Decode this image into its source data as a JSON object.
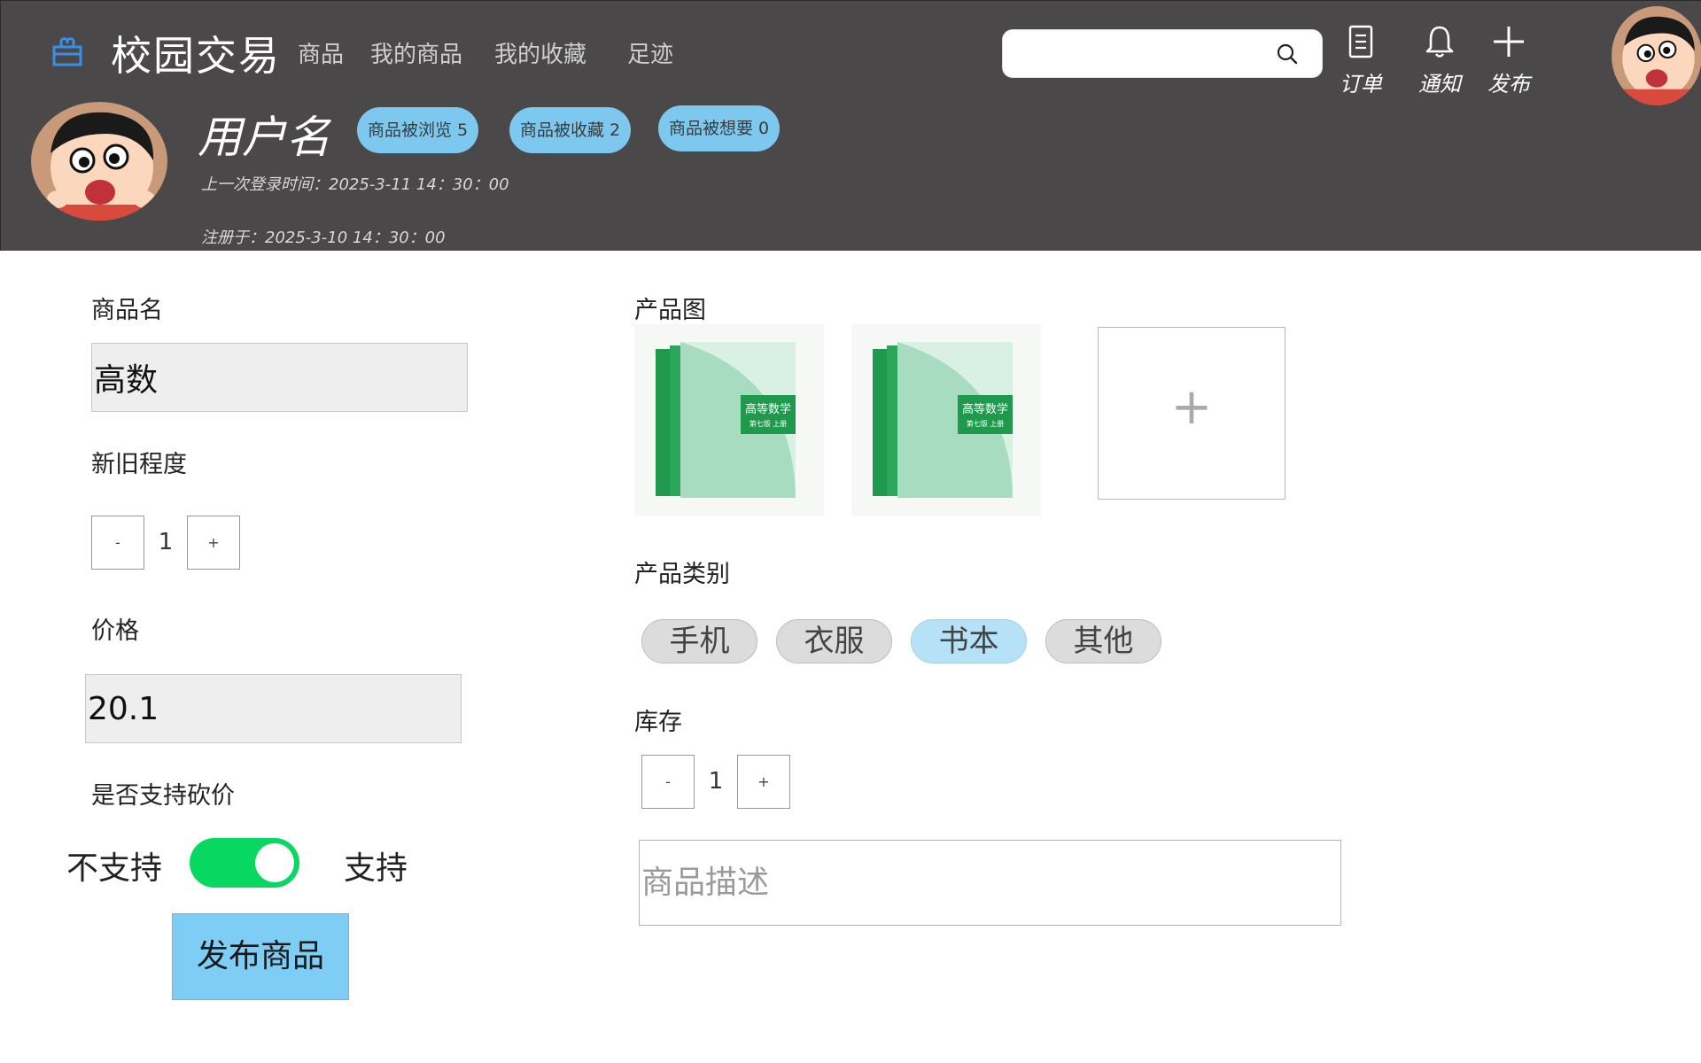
{
  "header": {
    "title": "校园交易",
    "nav": [
      {
        "label": "商品"
      },
      {
        "label": "我的商品"
      },
      {
        "label": "我的收藏"
      },
      {
        "label": "足迹"
      }
    ],
    "search": {
      "value": "",
      "placeholder": ""
    },
    "tools": {
      "orders": "订单",
      "notifications": "通知",
      "publish": "发布"
    }
  },
  "profile": {
    "username": "用户名",
    "badges": [
      {
        "label": "商品被浏览 5"
      },
      {
        "label": "商品被收藏 2"
      },
      {
        "label": "商品被想要 0"
      }
    ],
    "last_login": "上一次登录时间：2025-3-11  14：30：00",
    "registered": "注册于：2025-3-10 14：30：00"
  },
  "form": {
    "name_label": "商品名",
    "name_value": "高数",
    "condition_label": "新旧程度",
    "condition": {
      "minus": "-",
      "value": "1",
      "plus": "+"
    },
    "price_label": "价格",
    "price_value": "20.1",
    "bargain_label": "是否支持砍价",
    "bargain_off": "不支持",
    "bargain_on": "支持",
    "bargain_enabled": true,
    "submit_label": "发布商品",
    "images_label": "产品图",
    "images": [
      {
        "title": "高等数学",
        "subtitle": "第七版 上册"
      },
      {
        "title": "高等数学",
        "subtitle": "第七版 上册"
      }
    ],
    "add_image": "+",
    "category_label": "产品类别",
    "categories": [
      {
        "label": "手机"
      },
      {
        "label": "衣服"
      },
      {
        "label": "书本"
      },
      {
        "label": "其他"
      }
    ],
    "selected_category": "书本",
    "stock_label": "库存",
    "stock": {
      "minus": "-",
      "value": "1",
      "plus": "+"
    },
    "description_placeholder": "商品描述",
    "description_value": ""
  },
  "colors": {
    "header_bg": "#4a4848",
    "badge_bg": "#7cc8ee",
    "toggle_on": "#08d862",
    "submit_bg": "#7ecdf5",
    "category_active": "#b6e2f7",
    "logo_accent": "#3a8ee6"
  },
  "icons": {
    "logo": "gift-box-icon",
    "search": "search-icon",
    "orders": "document-icon",
    "notifications": "bell-icon",
    "publish": "plus-icon"
  }
}
